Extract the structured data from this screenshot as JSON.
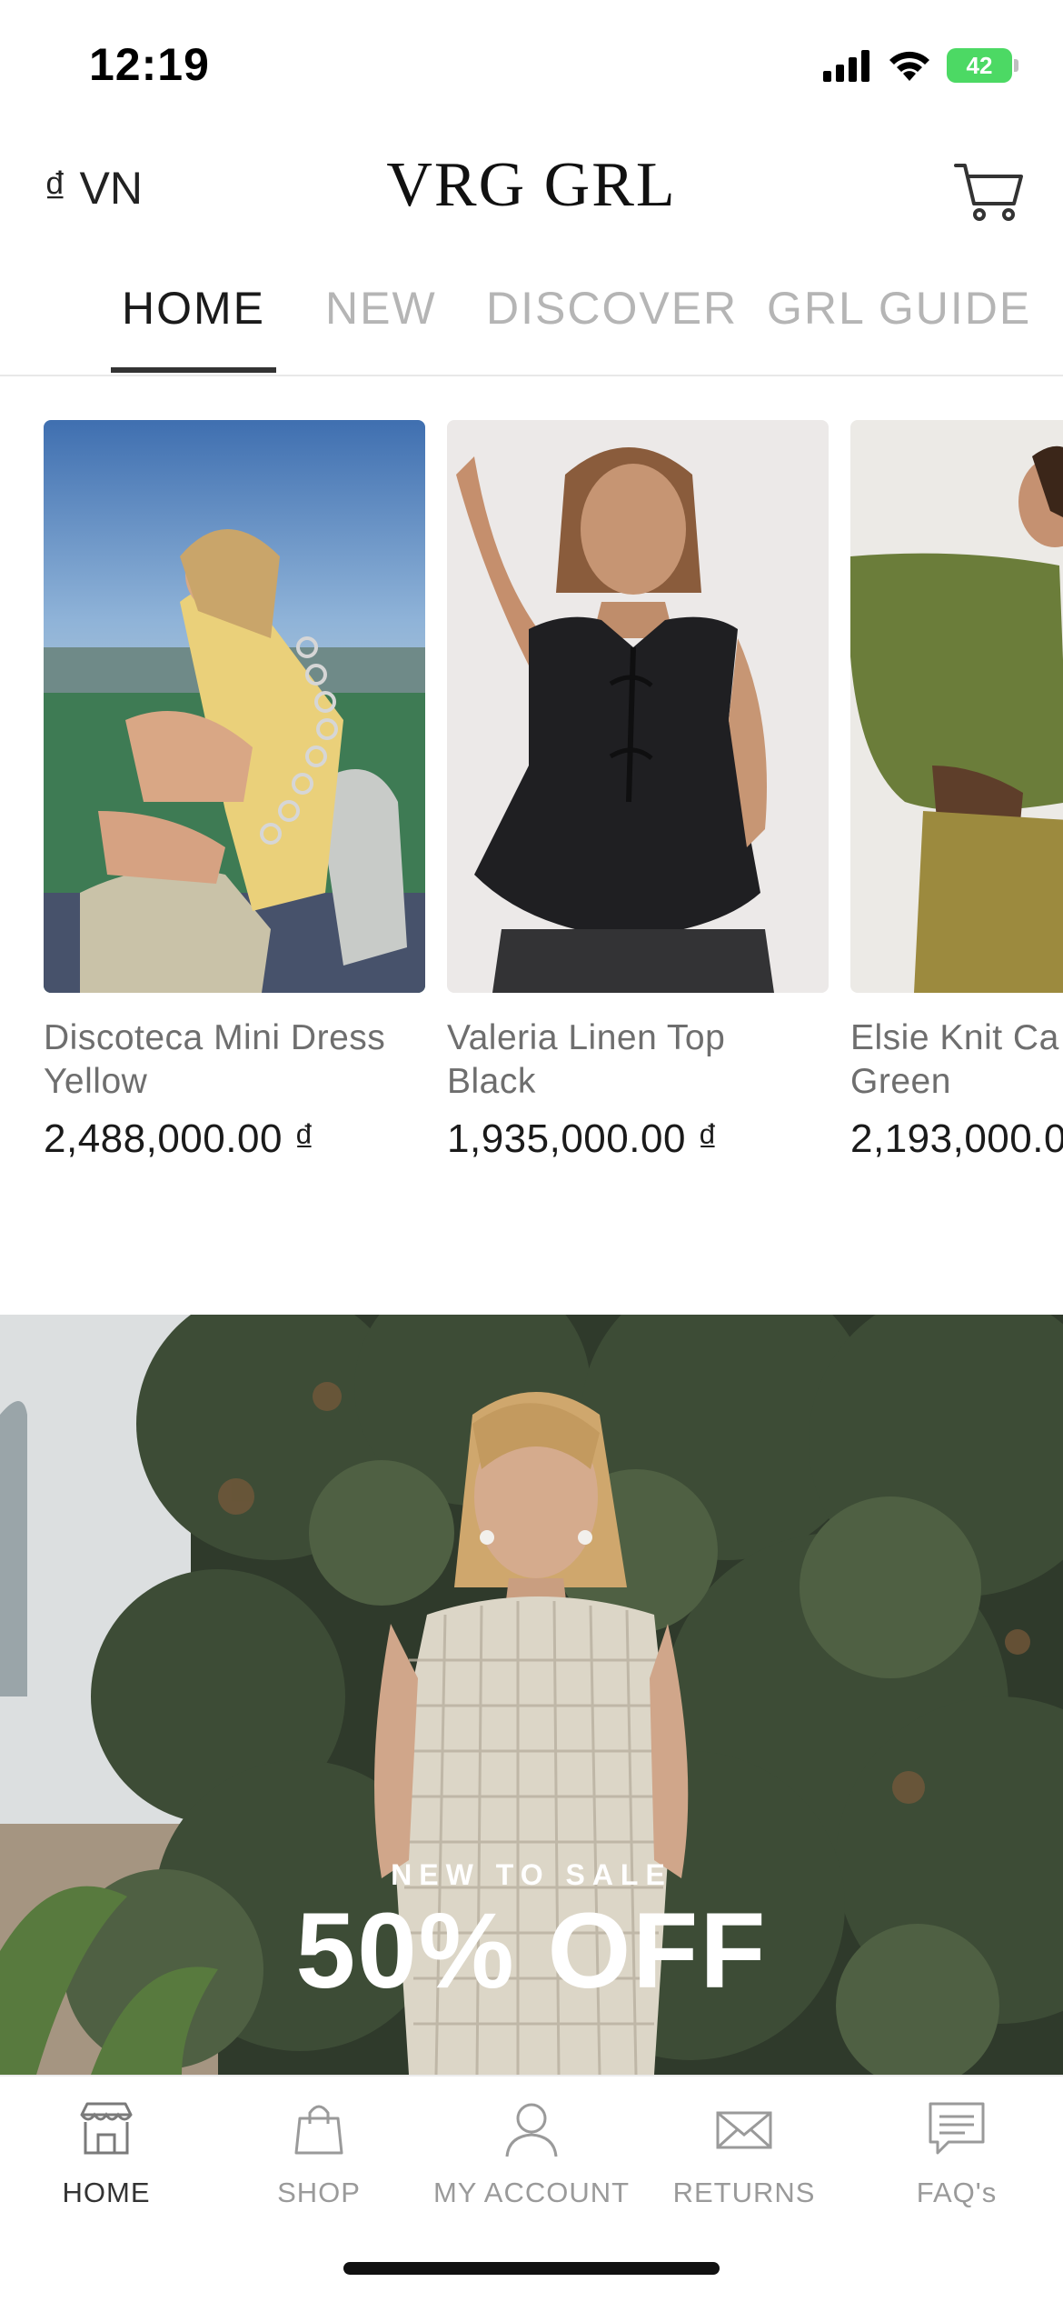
{
  "status_bar": {
    "time": "12:19",
    "battery": "42",
    "icons": [
      "signal-icon",
      "wifi-icon",
      "battery-icon"
    ]
  },
  "header": {
    "currency": "₫ VN",
    "brand": "VRG GRL",
    "cart_icon": "cart-icon"
  },
  "tabs": [
    {
      "label": "HOME",
      "active": true
    },
    {
      "label": "NEW",
      "active": false
    },
    {
      "label": "DISCOVER",
      "active": false
    },
    {
      "label": "GRL GUIDE",
      "active": false
    }
  ],
  "products": [
    {
      "name_line1": "Discoteca Mini Dress",
      "name_line2": "Yellow",
      "price": "2,488,000.00 ₫"
    },
    {
      "name_line1": "Valeria Linen Top",
      "name_line2": "Black",
      "price": "1,935,000.00 ₫"
    },
    {
      "name_line1": "Elsie Knit Ca",
      "name_line2": "Green",
      "price": "2,193,000.0"
    }
  ],
  "banner": {
    "eyebrow": "NEW TO SALE",
    "headline": "50% OFF"
  },
  "bottom_nav": [
    {
      "label": "HOME",
      "icon": "store-icon",
      "active": true
    },
    {
      "label": "SHOP",
      "icon": "shopping-bag-icon",
      "active": false
    },
    {
      "label": "MY ACCOUNT",
      "icon": "user-icon",
      "active": false
    },
    {
      "label": "RETURNS",
      "icon": "envelope-icon",
      "active": false
    },
    {
      "label": "FAQ's",
      "icon": "chat-icon",
      "active": false
    }
  ],
  "colors": {
    "accent": "#1a1a1a",
    "inactive_text": "#b5b5b5",
    "battery_green": "#4cd964"
  }
}
